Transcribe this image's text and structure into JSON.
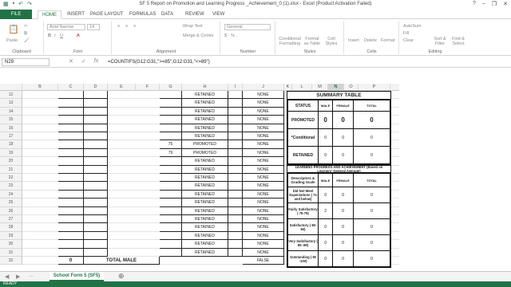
{
  "window": {
    "title": "SF 5 Report on Promotion and Learning Progress _Achievement_0 (1).xlsx - Excel (Product Activation Failed)"
  },
  "ribbon_tabs": [
    "FILE",
    "HOME",
    "INSERT",
    "PAGE LAYOUT",
    "FORMULAS",
    "DATA",
    "REVIEW",
    "VIEW"
  ],
  "ribbon": {
    "paste_label": "Paste",
    "font_name": "Arial Narrow",
    "font_size": "14",
    "wrap_text": "Wrap Text",
    "merge_center": "Merge & Center",
    "number_format": "General",
    "conditional_formatting": "Conditional Formatting",
    "format_as_table": "Format as Table",
    "cell_styles": "Cell Styles",
    "insert": "Insert",
    "delete": "Delete",
    "format": "Format",
    "autosum": "AutoSum",
    "fill": "Fill",
    "clear": "Clear",
    "sort_filter": "Sort & Filter",
    "find_select": "Find & Select",
    "groups": [
      "Clipboard",
      "Font",
      "Alignment",
      "Number",
      "Styles",
      "Cells",
      "Editing"
    ]
  },
  "formula_bar": {
    "name_box": "N29",
    "formula": "=COUNTIFS(G12:G31,\">=85\",G12:G31,\"<=89\")"
  },
  "columns": [
    "B",
    "C",
    "D",
    "E",
    "F",
    "G",
    "H",
    "I",
    "J",
    "K",
    "L",
    "M",
    "N",
    "O",
    "P"
  ],
  "rows": [
    "12",
    "13",
    "14",
    "15",
    "16",
    "17",
    "18",
    "19",
    "20",
    "21",
    "22",
    "23",
    "24",
    "25",
    "26",
    "27",
    "28",
    "29",
    "30",
    "31",
    "32"
  ],
  "grid_rows": [
    {
      "g": "",
      "h": "RETAINED",
      "j": "NONE"
    },
    {
      "g": "",
      "h": "RETAINED",
      "j": "NONE"
    },
    {
      "g": "",
      "h": "RETAINED",
      "j": "NONE"
    },
    {
      "g": "",
      "h": "RETAINED",
      "j": "NONE"
    },
    {
      "g": "",
      "h": "RETAINED",
      "j": "NONE"
    },
    {
      "g": "",
      "h": "RETAINED",
      "j": "NONE"
    },
    {
      "g": "75",
      "h": "PROMOTED",
      "j": "NONE"
    },
    {
      "g": "79",
      "h": "PROMOTED",
      "j": "NONE"
    },
    {
      "g": "",
      "h": "RETAINED",
      "j": "NONE"
    },
    {
      "g": "",
      "h": "RETAINED",
      "j": "NONE"
    },
    {
      "g": "",
      "h": "RETAINED",
      "j": "NONE"
    },
    {
      "g": "",
      "h": "RETAINED",
      "j": "NONE"
    },
    {
      "g": "",
      "h": "RETAINED",
      "j": "NONE"
    },
    {
      "g": "",
      "h": "RETAINED",
      "j": "NONE"
    },
    {
      "g": "",
      "h": "RETAINED",
      "j": "NONE"
    },
    {
      "g": "",
      "h": "RETAINED",
      "j": "NONE"
    },
    {
      "g": "",
      "h": "RETAINED",
      "j": "NONE"
    },
    {
      "g": "",
      "h": "RETAINED",
      "j": "NONE"
    },
    {
      "g": "",
      "h": "RETAINED",
      "j": "NONE"
    },
    {
      "g": "",
      "h": "RETAINED",
      "j": "NONE"
    }
  ],
  "total_row": {
    "count": "0",
    "label": "TOTAL MALE",
    "j": "FALSE"
  },
  "summary": {
    "title": "SUMMARY TABLE",
    "headers": [
      "STATUS",
      "MALE",
      "FEMALE",
      "TOTAL"
    ],
    "rows": [
      {
        "status": "PROMOTED",
        "male": "0",
        "female": "0",
        "total": "0"
      },
      {
        "status": "*Conditional",
        "male": "0",
        "female": "0",
        "total": "0"
      },
      {
        "status": "RETAINED",
        "male": "0",
        "female": "0",
        "total": "0"
      }
    ]
  },
  "learning": {
    "title": "LEARNING PROGRESS AND ACHIEVEMENT (Based on Learners' General Average)",
    "headers": [
      "Descriptors & Grading Scale",
      "MALE",
      "FEMALE",
      "TOTAL"
    ],
    "rows": [
      {
        "desc": "Did Not Meet Expectations ( 74 and below)",
        "male": "0",
        "female": "0",
        "total": "0"
      },
      {
        "desc": "Fairly Satisfactory ( 75-79)",
        "male": "2",
        "female": "0",
        "total": "0"
      },
      {
        "desc": "Satisfactory ( 80-84)",
        "male": "0",
        "female": "0",
        "total": "0"
      },
      {
        "desc": "Very Satisfactory ( 85 -89)",
        "male": "0",
        "female": "0",
        "total": "0"
      },
      {
        "desc": "Outstanding ( 90 -100)",
        "male": "0",
        "female": "0",
        "total": "0"
      }
    ]
  },
  "sheet_tab": "School Form 5 (SF5)",
  "status": "READY",
  "colors": {
    "accent": "#217346"
  }
}
